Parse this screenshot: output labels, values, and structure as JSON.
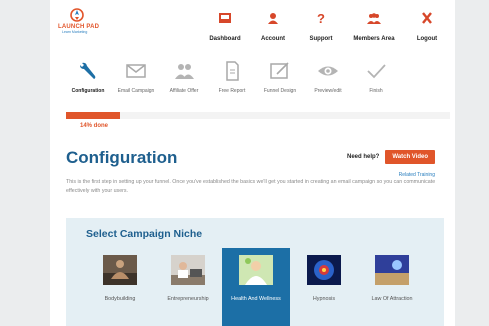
{
  "brand": {
    "name": "LAUNCH PAD",
    "tagline": "Learn Marketing"
  },
  "topnav": [
    {
      "label": "Dashboard",
      "icon": "dashboard-icon"
    },
    {
      "label": "Account",
      "icon": "user-icon"
    },
    {
      "label": "Support",
      "icon": "question-icon"
    },
    {
      "label": "Members Area",
      "icon": "members-icon"
    },
    {
      "label": "Logout",
      "icon": "close-icon"
    }
  ],
  "steps": [
    {
      "label": "Configuration",
      "icon": "wrench-icon",
      "active": true
    },
    {
      "label": "Email Campaign",
      "icon": "envelope-icon"
    },
    {
      "label": "Affiliate Offer",
      "icon": "people-icon"
    },
    {
      "label": "Free Report",
      "icon": "document-icon"
    },
    {
      "label": "Funnel Design",
      "icon": "design-icon"
    },
    {
      "label": "Preview/edit",
      "icon": "eye-icon"
    },
    {
      "label": "Finish",
      "icon": "check-icon"
    }
  ],
  "progress": {
    "fraction": 0.14,
    "label": "14% done"
  },
  "page": {
    "title": "Configuration",
    "help_question": "Need help?",
    "watch_video": "Watch Video",
    "related_training": "Related Training",
    "description": "This is the first step in setting up your funnel. Once you've established the basics we'll get you started in creating an email campaign so you can communicate effectively with your users."
  },
  "niche": {
    "title": "Select Campaign Niche",
    "items": [
      {
        "label": "Bodybuilding",
        "icon": "bodybuilding-image"
      },
      {
        "label": "Entrepreneurship",
        "icon": "entrepreneurship-image"
      },
      {
        "label": "Health And Wellness",
        "icon": "health-image",
        "selected": true
      },
      {
        "label": "Hypnosis",
        "icon": "hypnosis-image"
      },
      {
        "label": "Law Of Attraction",
        "icon": "attraction-image"
      }
    ]
  },
  "colors": {
    "accent": "#e0552a",
    "primary": "#1e5f8e",
    "selected": "#1c6fa6",
    "panel": "#e4eff4"
  }
}
